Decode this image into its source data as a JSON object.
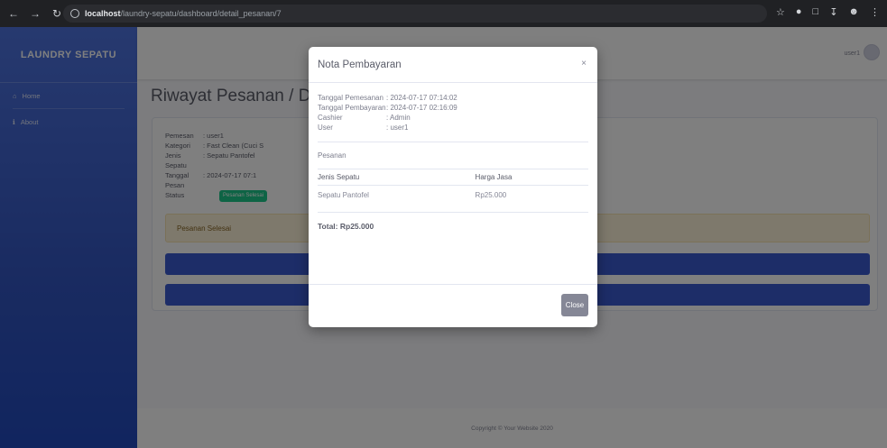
{
  "browser": {
    "url_host": "localhost",
    "url_path": "/laundry-sepatu/dashboard/detail_pesanan/7",
    "back_icon": "arrow-left-icon",
    "forward_icon": "arrow-right-icon",
    "reload_icon": "reload-icon"
  },
  "sidebar": {
    "brand": "LAUNDRY SEPATU",
    "items": [
      {
        "label": "Home",
        "icon": "home-icon"
      },
      {
        "label": "About",
        "icon": "info-icon"
      }
    ]
  },
  "topbar": {
    "user": "user1"
  },
  "main": {
    "page_title": "Riwayat Pesanan / De",
    "info": {
      "pemesan_key": "Pemesan",
      "pemesan_val": ": user1",
      "kategori_key": "Kategori",
      "kategori_val": ": Fast Clean (Cuci S",
      "jenis_key": "Jenis Sepatu",
      "jenis_val": ": Sepatu Pantofel",
      "tanggal_key": "Tanggal Pesan",
      "tanggal_val": ": 2024-07-17 07:1",
      "status_key": "Status",
      "status_badge": "Pesanan Selesai"
    },
    "alert": "Pesanan Selesai"
  },
  "footer": {
    "text": "Copyright © Your Website 2020"
  },
  "modal": {
    "title": "Nota Pembayaran",
    "close_x": "×",
    "rows": [
      {
        "key": "Tanggal Pemesanan",
        "val": ": 2024-07-17 07:14:02"
      },
      {
        "key": "Tanggal Pembayaran",
        "val": ": 2024-07-17 02:16:09"
      },
      {
        "key": "Cashier",
        "val": ": Admin"
      },
      {
        "key": "User",
        "val": ": user1"
      }
    ],
    "pesanan_label": "Pesanan",
    "table": {
      "headers": [
        "Jenis Sepatu",
        "Harga Jasa"
      ],
      "rows": [
        [
          "Sepatu Pantofel",
          "Rp25.000"
        ]
      ]
    },
    "total": "Total: Rp25.000",
    "close_button": "Close"
  }
}
